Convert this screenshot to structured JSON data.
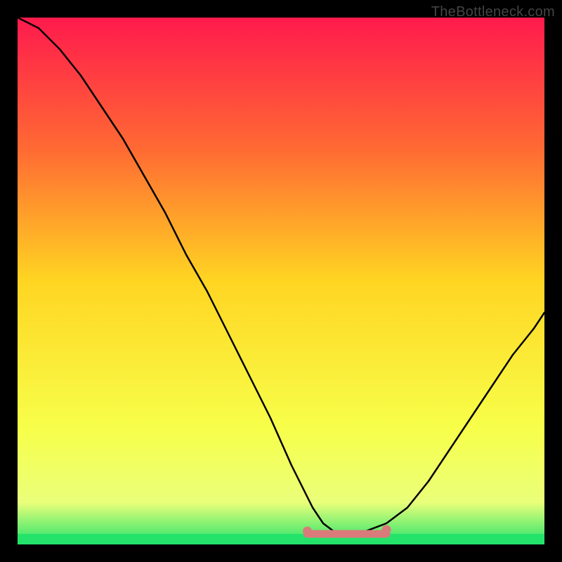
{
  "watermark": "TheBottleneck.com",
  "colors": {
    "background": "#000000",
    "gradient_top": "#ff1a4d",
    "gradient_upper_mid": "#ff6a33",
    "gradient_mid": "#ffd522",
    "gradient_lower_mid": "#f7ff4a",
    "gradient_bottom_band": "#eaff7a",
    "gradient_bottom": "#24e36b",
    "curve_stroke": "#000000",
    "optimal_marker": "#d97b7b"
  },
  "chart_data": {
    "type": "line",
    "title": "",
    "xlabel": "",
    "ylabel": "",
    "xlim": [
      0,
      100
    ],
    "ylim": [
      0,
      100
    ],
    "series": [
      {
        "name": "bottleneck-curve",
        "x": [
          0,
          4,
          8,
          12,
          16,
          20,
          24,
          28,
          32,
          36,
          40,
          44,
          48,
          52,
          54,
          56,
          58,
          60,
          62,
          64,
          66,
          70,
          74,
          78,
          82,
          86,
          90,
          94,
          98,
          100
        ],
        "y": [
          100,
          98,
          94,
          89,
          83,
          77,
          70,
          63,
          55,
          48,
          40,
          32,
          24,
          15,
          11,
          7,
          4,
          2.5,
          2,
          2,
          2.5,
          4,
          7,
          12,
          18,
          24,
          30,
          36,
          41,
          44
        ]
      }
    ],
    "optimal_zone": {
      "x_start": 55,
      "x_end": 70,
      "y": 2
    }
  }
}
